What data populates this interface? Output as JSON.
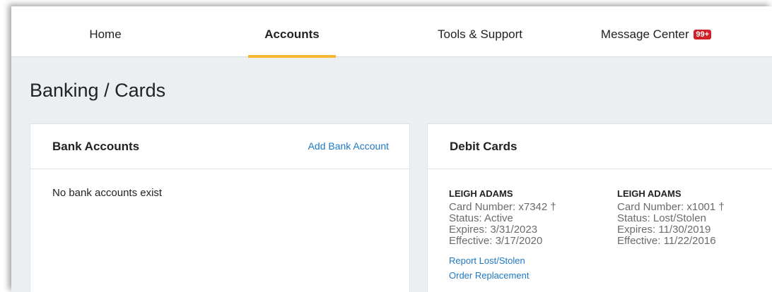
{
  "nav": {
    "items": [
      {
        "label": "Home"
      },
      {
        "label": "Accounts"
      },
      {
        "label": "Tools & Support"
      },
      {
        "label": "Message Center"
      }
    ],
    "badge": "99+",
    "accent_color": "#f5b731"
  },
  "page_title": "Banking / Cards",
  "bank_accounts": {
    "title": "Bank Accounts",
    "add_link": "Add Bank Account",
    "empty_text": "No bank accounts exist"
  },
  "debit_cards": {
    "title": "Debit Cards",
    "cards": [
      {
        "holder": "LEIGH ADAMS",
        "card_number": "Card Number: x7342 †",
        "status": "Status: Active",
        "expires": "Expires: 3/31/2023",
        "effective": "Effective: 3/17/2020",
        "actions": [
          "Report Lost/Stolen",
          "Order Replacement"
        ]
      },
      {
        "holder": "LEIGH ADAMS",
        "card_number": "Card Number: x1001 †",
        "status": "Status: Lost/Stolen",
        "expires": "Expires: 11/30/2019",
        "effective": "Effective: 11/22/2016"
      }
    ]
  }
}
